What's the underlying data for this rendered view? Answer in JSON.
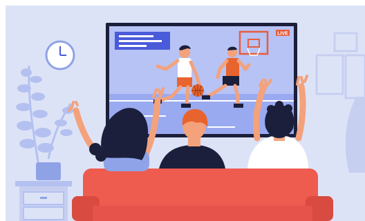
{
  "scene": {
    "description_free": true,
    "live_badge": {
      "label": "LIVE"
    },
    "palette": {
      "wall": "#dde3f7",
      "wall_frame": "#c9d1ef",
      "tv_bezel": "#1c1f3a",
      "tv_screen": "#a6b5f2",
      "tv_screen_light": "#c2ccf6",
      "court_line": "#ffffff",
      "sofa": "#ee5b4f",
      "sofa_dark": "#d94a40",
      "skin": "#f3a27c",
      "hair_dark": "#1b1f3b",
      "hair_orange": "#e8642e",
      "shirt_white": "#ffffff",
      "shirt_blue": "#8fa4e8",
      "shirt_navy": "#1b1f3b",
      "plant": "#b4c1f0",
      "accent_blue": "#4a5bd9",
      "hoop_red": "#e85c3c"
    },
    "icons": [
      "clock-icon",
      "basketball-icon",
      "hoop-icon",
      "plant-icon"
    ]
  }
}
